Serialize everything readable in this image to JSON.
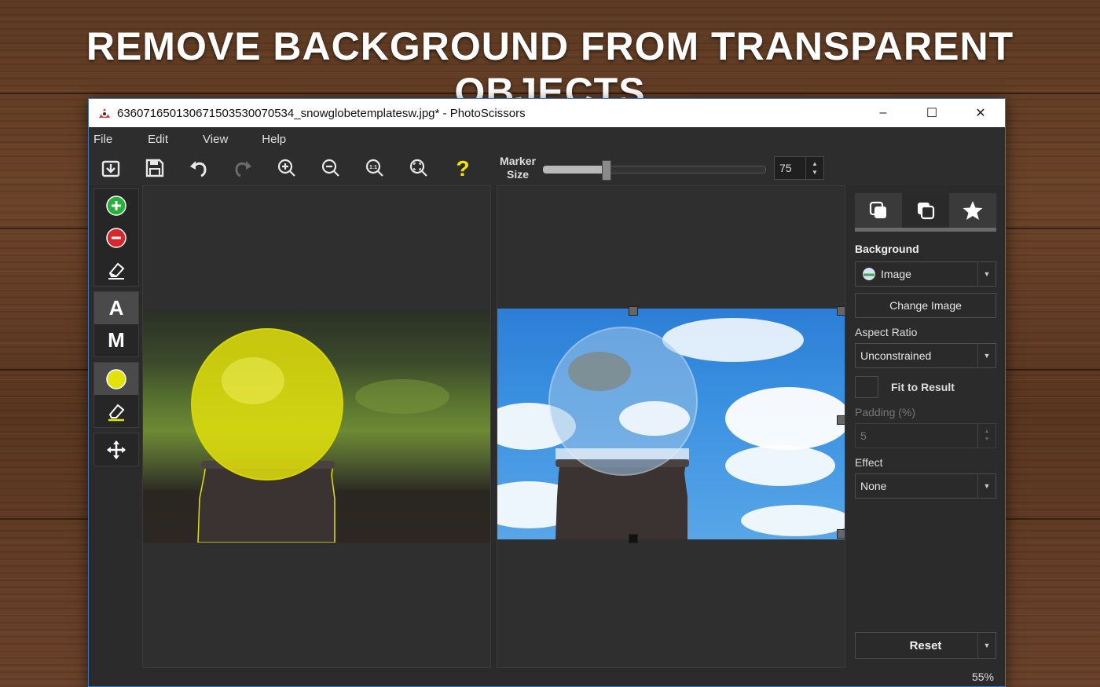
{
  "headline": "REMOVE BACKGROUND FROM TRANSPARENT OBJECTS",
  "window": {
    "title": "636071650130671503530070534_snowglobetemplatesw.jpg* - PhotoScissors",
    "minimize": "–",
    "maximize": "☐",
    "close": "✕"
  },
  "menu": [
    "File",
    "Edit",
    "View",
    "Help"
  ],
  "toolbar": {
    "marker_label_1": "Marker",
    "marker_label_2": "Size",
    "marker_size": "75",
    "marker_fraction": 0.28,
    "icons": [
      "open-icon",
      "save-icon",
      "undo-icon",
      "redo-icon",
      "zoom-in-icon",
      "zoom-out-icon",
      "actual-size-icon",
      "fit-icon",
      "help-icon"
    ]
  },
  "left_tools": {
    "auto_label": "A",
    "manual_label": "M"
  },
  "side": {
    "background_label": "Background",
    "background_value": "Image",
    "change_image": "Change Image",
    "aspect_ratio_label": "Aspect Ratio",
    "aspect_ratio_value": "Unconstrained",
    "fit_to_result": "Fit to Result",
    "padding_label": "Padding (%)",
    "padding_value": "5",
    "effect_label": "Effect",
    "effect_value": "None",
    "reset": "Reset"
  },
  "zoom": "55%",
  "colors": {
    "accent_green": "#27b03a",
    "accent_red": "#d8262c",
    "marker_yellow": "#e2e10a",
    "help_yellow": "#f2e600"
  }
}
